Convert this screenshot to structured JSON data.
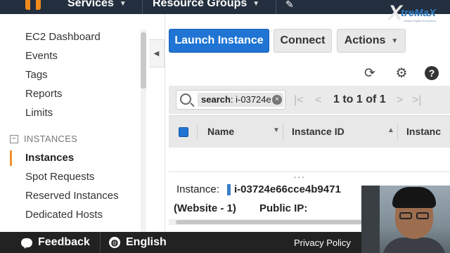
{
  "nav": {
    "services_label": "Services",
    "resource_groups_label": "Resource Groups"
  },
  "brand": {
    "name": "treMaX",
    "tagline": "Unique Digital Innovations"
  },
  "sidebar": {
    "items": [
      {
        "label": "EC2 Dashboard"
      },
      {
        "label": "Events"
      },
      {
        "label": "Tags"
      },
      {
        "label": "Reports"
      },
      {
        "label": "Limits"
      }
    ],
    "section_title": "INSTANCES",
    "section_items": [
      {
        "label": "Instances",
        "active": true
      },
      {
        "label": "Spot Requests"
      },
      {
        "label": "Reserved Instances"
      },
      {
        "label": "Dedicated Hosts"
      }
    ]
  },
  "toolbar": {
    "launch_label": "Launch Instance",
    "connect_label": "Connect",
    "actions_label": "Actions"
  },
  "search": {
    "key": "search",
    "value": ": i-03724e"
  },
  "pagination": {
    "text": "1 to 1 of 1"
  },
  "table": {
    "columns": [
      "Name",
      "Instance ID",
      "Instanc"
    ]
  },
  "details": {
    "instance_label": "Instance:",
    "instance_id": "i-03724e66cce4b9471",
    "instance_name": "(Website - 1)",
    "public_ip_label": "Public IP:"
  },
  "footer": {
    "feedback_label": "Feedback",
    "language_label": "English",
    "privacy_label": "Privacy Policy"
  },
  "colors": {
    "nav_bg": "#232f3e",
    "primary": "#1f74d4",
    "active_marker": "#ec912d",
    "footer_bg": "#222222"
  }
}
